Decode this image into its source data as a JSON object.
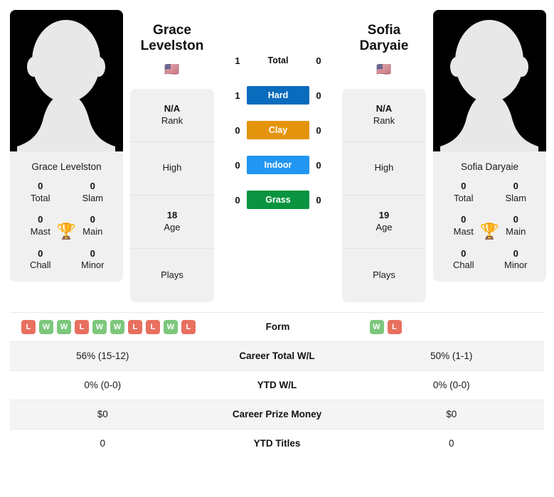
{
  "players": {
    "left": {
      "display_name": "Grace Levelston",
      "name_line1": "Grace",
      "name_line2": "Levelston",
      "flag": "🇺🇸",
      "card_name": "Grace Levelston",
      "titles": {
        "total_num": "0",
        "total_lab": "Total",
        "slam_num": "0",
        "slam_lab": "Slam",
        "mast_num": "0",
        "mast_lab": "Mast",
        "main_num": "0",
        "main_lab": "Main",
        "chall_num": "0",
        "chall_lab": "Chall",
        "minor_num": "0",
        "minor_lab": "Minor"
      },
      "info": {
        "rank_val": "N/A",
        "rank_lab": "Rank",
        "high_val": "",
        "high_lab": "High",
        "age_val": "18",
        "age_lab": "Age",
        "plays_val": "",
        "plays_lab": "Plays"
      }
    },
    "right": {
      "display_name": "Sofia Daryaie",
      "name_line1": "Sofia Daryaie",
      "name_line2": "",
      "flag": "🇺🇸",
      "card_name": "Sofia Daryaie",
      "titles": {
        "total_num": "0",
        "total_lab": "Total",
        "slam_num": "0",
        "slam_lab": "Slam",
        "mast_num": "0",
        "mast_lab": "Mast",
        "main_num": "0",
        "main_lab": "Main",
        "chall_num": "0",
        "chall_lab": "Chall",
        "minor_num": "0",
        "minor_lab": "Minor"
      },
      "info": {
        "rank_val": "N/A",
        "rank_lab": "Rank",
        "high_val": "",
        "high_lab": "High",
        "age_val": "19",
        "age_lab": "Age",
        "plays_val": "",
        "plays_lab": "Plays"
      }
    }
  },
  "trophy_icon": "🏆",
  "surfaces": [
    {
      "label": "Total",
      "left": "1",
      "right": "0",
      "color": "transparent",
      "plain": true
    },
    {
      "label": "Hard",
      "left": "1",
      "right": "0",
      "color": "#0a6cbd",
      "plain": false
    },
    {
      "label": "Clay",
      "left": "0",
      "right": "0",
      "color": "#e4940c",
      "plain": false
    },
    {
      "label": "Indoor",
      "left": "0",
      "right": "0",
      "color": "#2196f3",
      "plain": false
    },
    {
      "label": "Grass",
      "left": "0",
      "right": "0",
      "color": "#0a9440",
      "plain": false
    }
  ],
  "form": {
    "label": "Form",
    "left": [
      "L",
      "W",
      "W",
      "L",
      "W",
      "W",
      "L",
      "L",
      "W",
      "L"
    ],
    "right": [
      "W",
      "L"
    ],
    "win_color": "#7cc77c",
    "loss_color": "#e8705f"
  },
  "table_rows": [
    {
      "label": "Career Total W/L",
      "left": "56% (15-12)",
      "right": "50% (1-1)",
      "shaded": true
    },
    {
      "label": "YTD W/L",
      "left": "0% (0-0)",
      "right": "0% (0-0)",
      "shaded": false
    },
    {
      "label": "Career Prize Money",
      "left": "$0",
      "right": "$0",
      "shaded": true
    },
    {
      "label": "YTD Titles",
      "left": "0",
      "right": "0",
      "shaded": false
    }
  ]
}
